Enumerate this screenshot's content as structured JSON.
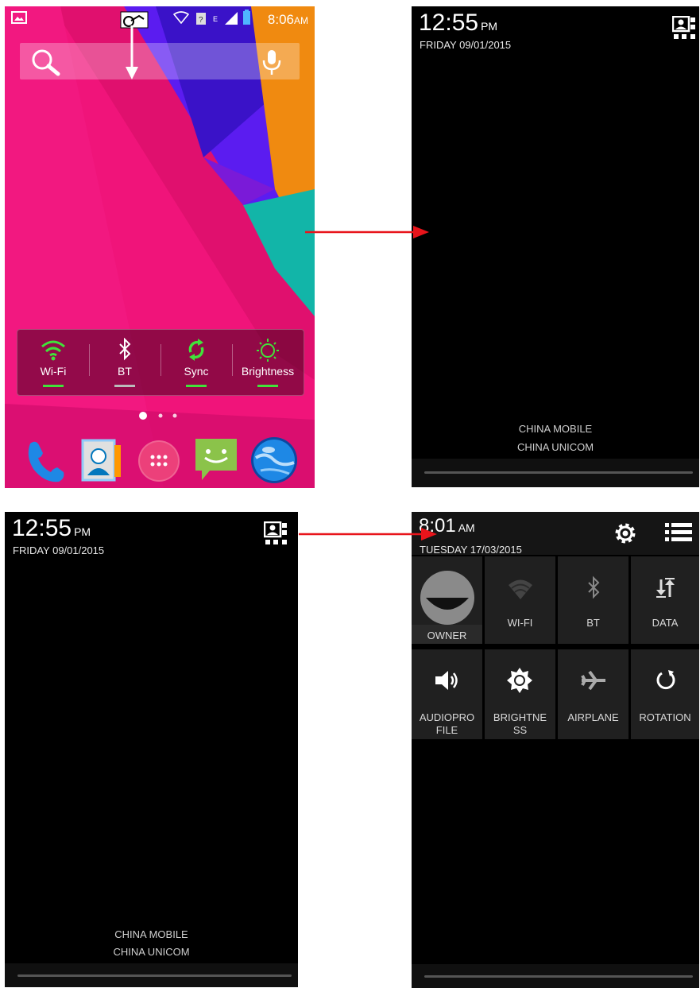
{
  "home": {
    "status_time": "8:06",
    "status_ampm": "AM",
    "network_type": "E",
    "quick_settings": [
      {
        "label": "Wi-Fi",
        "icon": "wifi-icon"
      },
      {
        "label": "BT",
        "icon": "bluetooth-icon"
      },
      {
        "label": "Sync",
        "icon": "sync-icon"
      },
      {
        "label": "Brightness",
        "icon": "brightness-icon"
      }
    ],
    "dock": [
      "phone-icon",
      "contacts-icon",
      "app-drawer-icon",
      "messaging-icon",
      "browser-icon"
    ],
    "page_indicator": {
      "pages": 3,
      "current": 1
    }
  },
  "lock_screen_1": {
    "time": "12:55",
    "ampm": "PM",
    "date": "FRIDAY 09/01/2015",
    "carriers": [
      "CHINA MOBILE",
      "CHINA UNICOM"
    ]
  },
  "lock_screen_2": {
    "time": "12:55",
    "ampm": "PM",
    "date": "FRIDAY 09/01/2015",
    "carriers": [
      "CHINA MOBILE",
      "CHINA UNICOM"
    ]
  },
  "shade": {
    "time": "8:01",
    "ampm": "AM",
    "date": "TUESDAY 17/03/2015",
    "tiles": [
      {
        "label": "OWNER",
        "icon": "owner-avatar-icon"
      },
      {
        "label": "WI-FI",
        "icon": "wifi-icon"
      },
      {
        "label": "BT",
        "icon": "bluetooth-icon"
      },
      {
        "label": "DATA",
        "icon": "data-icon"
      },
      {
        "label": "AUDIOPRO",
        "label2": "FILE",
        "icon": "volume-icon"
      },
      {
        "label": "BRIGHTNE",
        "label2": "SS",
        "icon": "brightness-icon"
      },
      {
        "label": "AIRPLANE",
        "icon": "airplane-icon"
      },
      {
        "label": "ROTATION",
        "icon": "rotation-icon"
      }
    ]
  },
  "colors": {
    "arrow": "#e8141b",
    "toggle_on": "#41e23a",
    "wallpaper_pink": "#f0147a"
  }
}
